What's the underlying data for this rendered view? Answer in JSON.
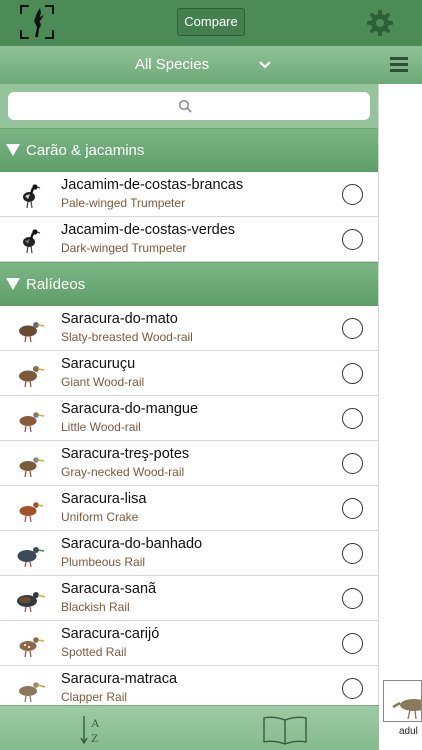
{
  "header": {
    "compare_label": "Compare"
  },
  "filter": {
    "label": "All Species"
  },
  "search": {
    "placeholder": ""
  },
  "sections": [
    {
      "title": "Carão & jacamins",
      "items": [
        {
          "name": "Jacamim-de-costas-brancas",
          "english": "Pale-winged Trumpeter",
          "icon": "trumpeter-bird-icon"
        },
        {
          "name": "Jacamim-de-costas-verdes",
          "english": "Dark-winged Trumpeter",
          "icon": "trumpeter-bird-icon"
        }
      ]
    },
    {
      "title": "Ralídeos",
      "items": [
        {
          "name": "Saracura-do-mato",
          "english": "Slaty-breasted Wood-rail",
          "icon": "rail-bird-icon"
        },
        {
          "name": "Saracuruçu",
          "english": "Giant Wood-rail",
          "icon": "rail-bird-icon"
        },
        {
          "name": "Saracura-do-mangue",
          "english": "Little Wood-rail",
          "icon": "rail-bird-icon"
        },
        {
          "name": "Saracura-treş-potes",
          "english": "Gray-necked Wood-rail",
          "icon": "rail-bird-icon"
        },
        {
          "name": "Saracura-lisa",
          "english": "Uniform Crake",
          "icon": "rail-bird-icon"
        },
        {
          "name": "Saracura-do-banhado",
          "english": "Plumbeous Rail",
          "icon": "rail-bird-icon"
        },
        {
          "name": "Saracura-sanã",
          "english": "Blackish Rail",
          "icon": "rail-bird-icon"
        },
        {
          "name": "Saracura-carijó",
          "english": "Spotted Rail",
          "icon": "rail-bird-icon"
        },
        {
          "name": "Saracura-matraca",
          "english": "Clapper Rail",
          "icon": "rail-bird-icon"
        }
      ]
    }
  ],
  "detail": {
    "thumb_label": "adul"
  },
  "colors": {
    "header": "#4d8b56",
    "section": "#6aa473",
    "english_name": "#7d5a3c"
  }
}
